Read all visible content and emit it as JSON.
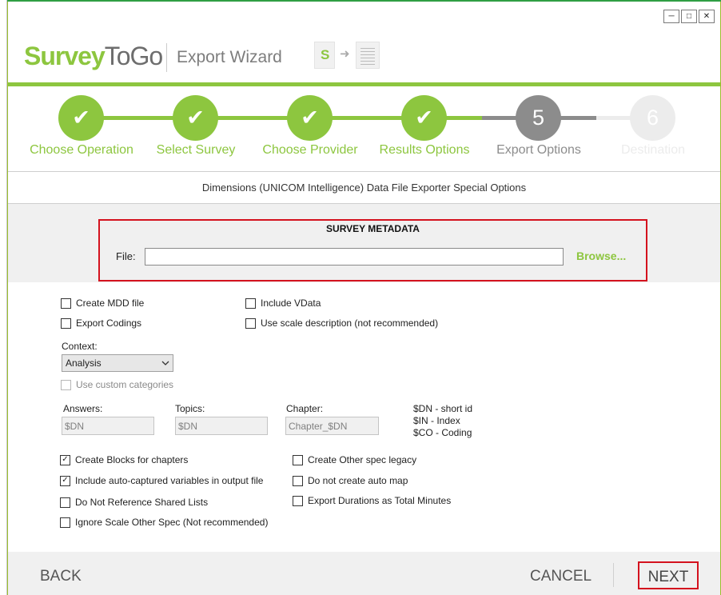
{
  "window": {
    "min": "─",
    "max": "□",
    "close": "✕"
  },
  "header": {
    "logo_part1": "Survey",
    "logo_part2": "ToGo",
    "title": "Export Wizard",
    "doc_letter": "S",
    "arrow_glyph": "➜"
  },
  "steps": [
    {
      "label": "Choose Operation",
      "state": "done",
      "mark": "✔"
    },
    {
      "label": "Select Survey",
      "state": "done",
      "mark": "✔"
    },
    {
      "label": "Choose Provider",
      "state": "done",
      "mark": "✔"
    },
    {
      "label": "Results Options",
      "state": "done",
      "mark": "✔"
    },
    {
      "label": "Export Options",
      "state": "current",
      "mark": "5"
    },
    {
      "label": "Destination",
      "state": "pending",
      "mark": "6"
    }
  ],
  "subtitle": "Dimensions (UNICOM Intelligence) Data File Exporter Special Options",
  "metadata": {
    "title": "SURVEY METADATA",
    "file_label": "File:",
    "file_value": "",
    "browse_label": "Browse..."
  },
  "options_top": [
    {
      "label": "Create MDD file",
      "checked": false
    },
    {
      "label": "Export Codings",
      "checked": false
    },
    {
      "label": "Include VData",
      "checked": false
    },
    {
      "label": "Use scale description (not recommended)",
      "checked": false
    }
  ],
  "context": {
    "label": "Context:",
    "selected": "Analysis",
    "use_custom_label": "Use custom categories"
  },
  "fields": {
    "answers_label": "Answers:",
    "answers_value": "$DN",
    "topics_label": "Topics:",
    "topics_value": "$DN",
    "chapter_label": "Chapter:",
    "chapter_value": "Chapter_$DN"
  },
  "legend": [
    "$DN - short id",
    "$IN - Index",
    "$CO - Coding"
  ],
  "options_bottom": [
    {
      "label": "Create Blocks for chapters",
      "checked": true
    },
    {
      "label": "Include auto-captured variables in output file",
      "checked": true
    },
    {
      "label": "Do Not Reference Shared Lists",
      "checked": false
    },
    {
      "label": "Ignore Scale Other Spec (Not recommended)",
      "checked": false
    },
    {
      "label": "Create Other spec legacy",
      "checked": false
    },
    {
      "label": "Do not create auto map",
      "checked": false
    },
    {
      "label": "Export Durations as Total Minutes",
      "checked": false
    }
  ],
  "footer": {
    "back": "BACK",
    "cancel": "CANCEL",
    "next": "NEXT"
  },
  "colors": {
    "brand_green": "#8dc63f",
    "highlight_red": "#d4121e",
    "current_step": "#8c8c8c",
    "pending_step": "#ececec"
  }
}
